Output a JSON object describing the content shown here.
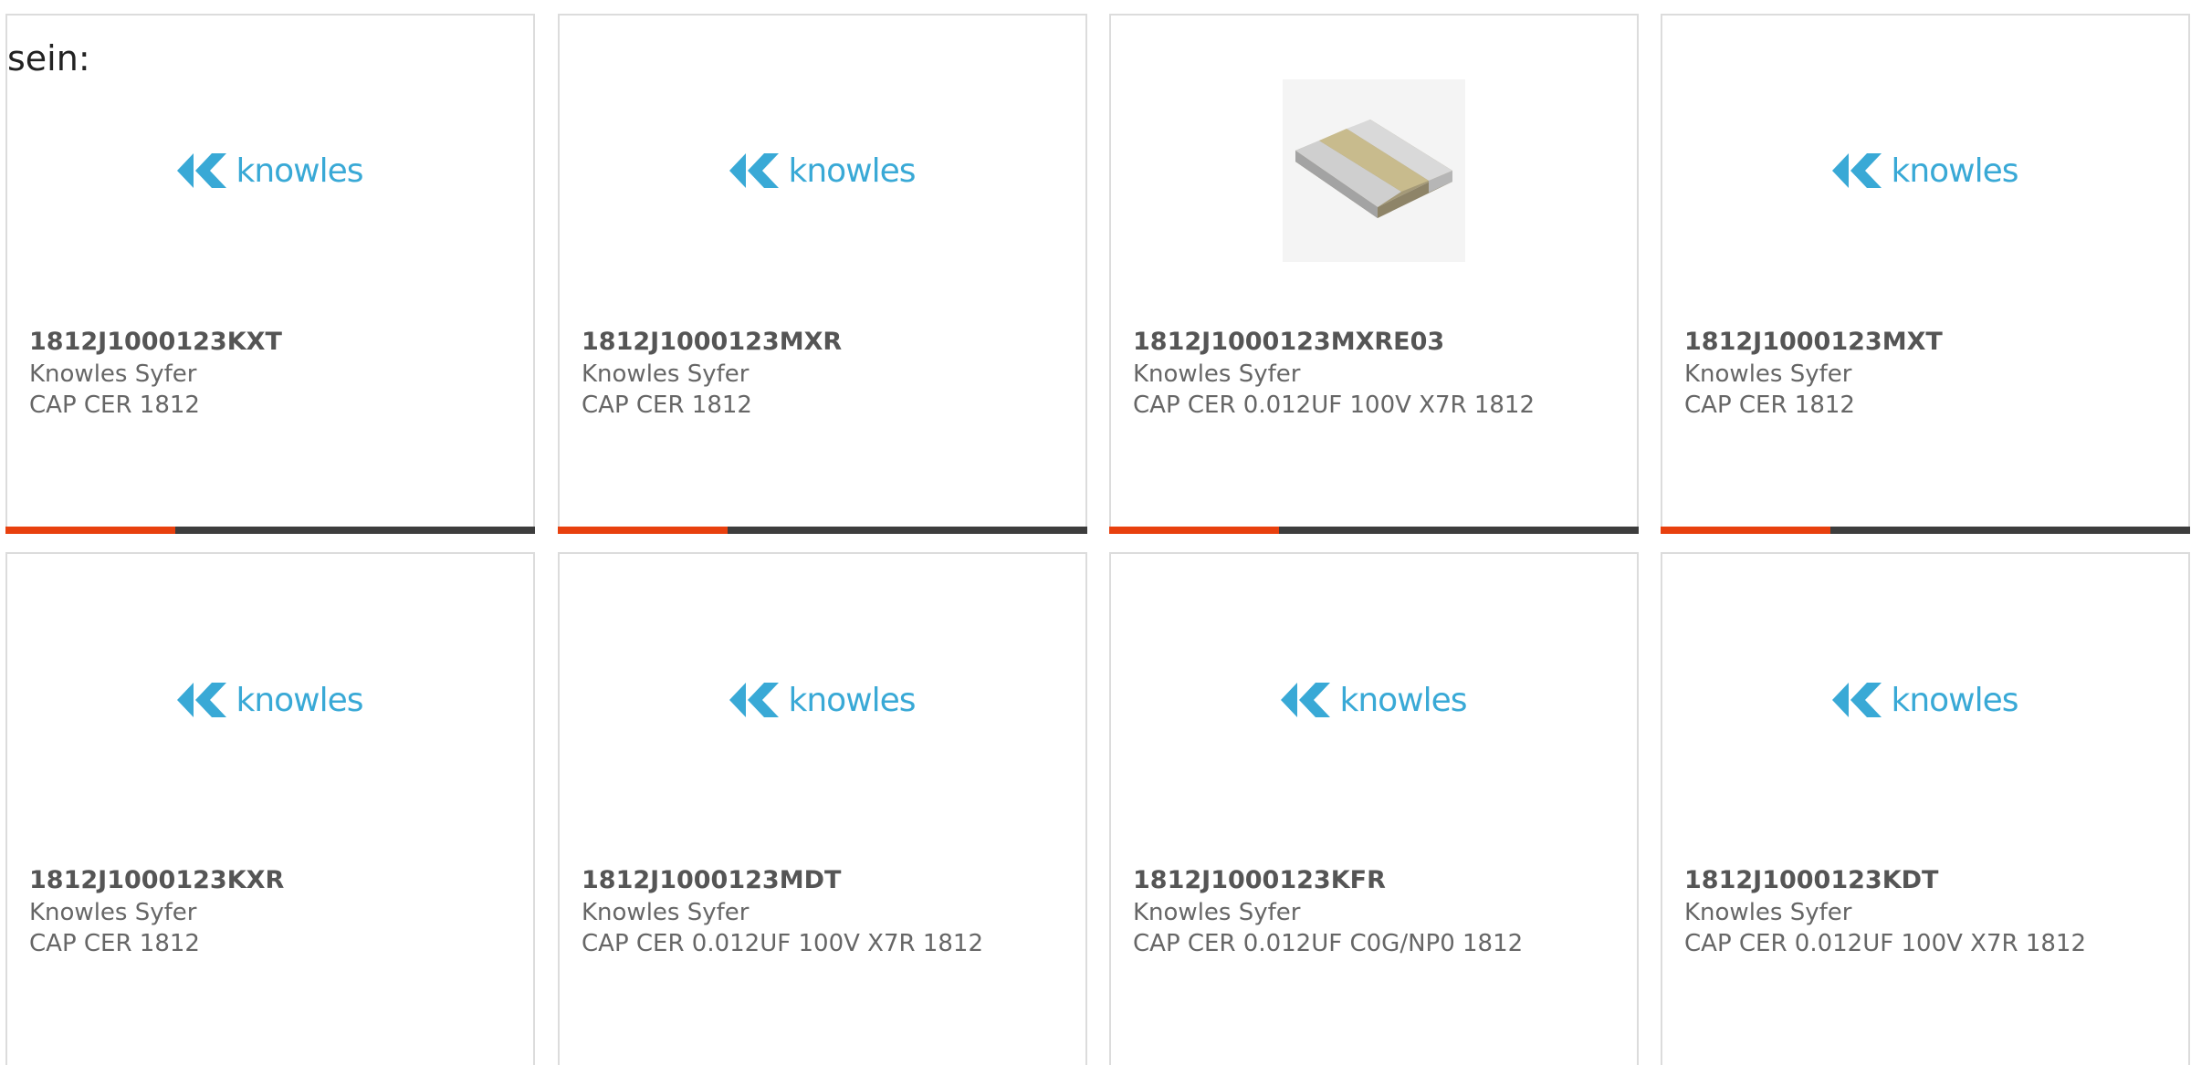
{
  "intro_text": "sein:",
  "brand": {
    "logo_text": "knowles",
    "logo_color": "#39a9d6",
    "accent_color": "#e8400e",
    "track_color": "#3d3d3d"
  },
  "cards": [
    {
      "part_no": "1812J1000123KXT",
      "maker": "Knowles Syfer",
      "desc": "CAP CER 1812",
      "image": "knowles-logo",
      "progress": 0.32
    },
    {
      "part_no": "1812J1000123MXR",
      "maker": "Knowles Syfer",
      "desc": "CAP CER 1812",
      "image": "knowles-logo",
      "progress": 0.32
    },
    {
      "part_no": "1812J1000123MXRE03",
      "maker": "Knowles Syfer",
      "desc": "CAP CER 0.012UF 100V X7R 1812",
      "image": "smd-capacitor-photo",
      "progress": 0.32
    },
    {
      "part_no": "1812J1000123MXT",
      "maker": "Knowles Syfer",
      "desc": "CAP CER 1812",
      "image": "knowles-logo",
      "progress": 0.32
    },
    {
      "part_no": "1812J1000123KXR",
      "maker": "Knowles Syfer",
      "desc": "CAP CER 1812",
      "image": "knowles-logo"
    },
    {
      "part_no": "1812J1000123MDT",
      "maker": "Knowles Syfer",
      "desc": "CAP CER 0.012UF 100V X7R 1812",
      "image": "knowles-logo"
    },
    {
      "part_no": "1812J1000123KFR",
      "maker": "Knowles Syfer",
      "desc": "CAP CER 0.012UF C0G/NP0 1812",
      "image": "knowles-logo"
    },
    {
      "part_no": "1812J1000123KDT",
      "maker": "Knowles Syfer",
      "desc": "CAP CER 0.012UF 100V X7R 1812",
      "image": "knowles-logo"
    }
  ]
}
